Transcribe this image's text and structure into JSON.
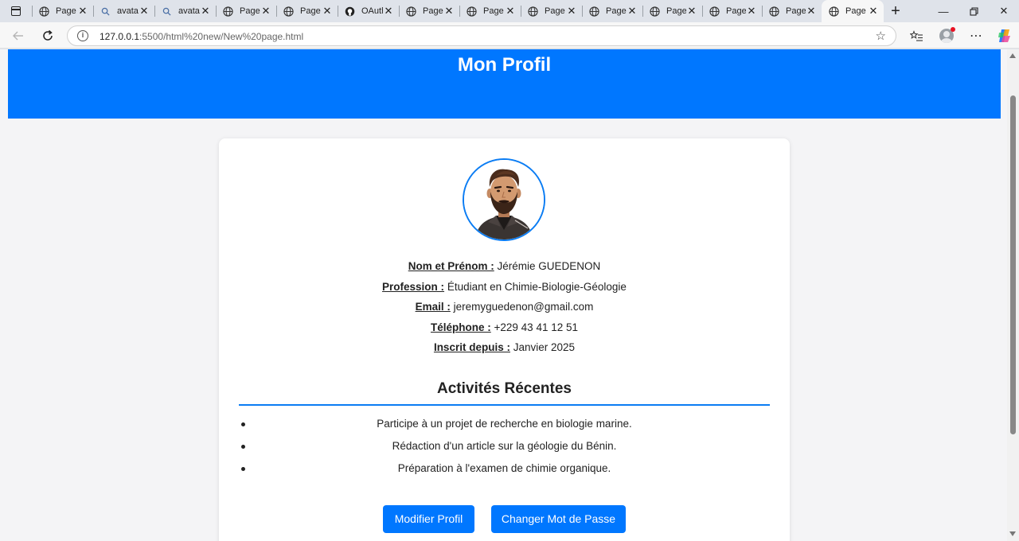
{
  "browser": {
    "tabs": [
      {
        "title": "Page",
        "icon": "globe-icon",
        "active": false
      },
      {
        "title": "avatar",
        "icon": "search-icon",
        "active": false
      },
      {
        "title": "avatar",
        "icon": "search-icon",
        "active": false
      },
      {
        "title": "Page",
        "icon": "globe-icon",
        "active": false
      },
      {
        "title": "Page",
        "icon": "globe-icon",
        "active": false
      },
      {
        "title": "OAuth",
        "icon": "github-icon",
        "active": false
      },
      {
        "title": "Page",
        "icon": "globe-icon",
        "active": false
      },
      {
        "title": "Page",
        "icon": "globe-icon",
        "active": false
      },
      {
        "title": "Page",
        "icon": "globe-icon",
        "active": false
      },
      {
        "title": "Page",
        "icon": "globe-icon",
        "active": false
      },
      {
        "title": "Page",
        "icon": "globe-icon",
        "active": false
      },
      {
        "title": "Page",
        "icon": "globe-icon",
        "active": false
      },
      {
        "title": "Page",
        "icon": "globe-icon",
        "active": false
      },
      {
        "title": "Page",
        "icon": "globe-icon",
        "active": true
      }
    ],
    "url": {
      "host": "127.0.0.1",
      "path": ":5500/html%20new/New%20page.html"
    }
  },
  "page": {
    "header_title": "Mon Profil",
    "profile": {
      "name_label": "Nom et Prénom :",
      "name_value": "Jérémie GUEDENON",
      "profession_label": "Profession :",
      "profession_value": "Étudiant en Chimie-Biologie-Géologie",
      "email_label": "Email :",
      "email_value": "jeremyguedenon@gmail.com",
      "phone_label": "Téléphone :",
      "phone_value": "+229 43 41 12 51",
      "since_label": "Inscrit depuis :",
      "since_value": "Janvier 2025"
    },
    "activities": {
      "title": "Activités Récentes",
      "items": [
        "Participe à un projet de recherche en biologie marine.",
        "Rédaction d'un article sur la géologie du Bénin.",
        "Préparation à l'examen de chimie organique."
      ]
    },
    "buttons": {
      "edit": "Modifier Profil",
      "password": "Changer Mot de Passe"
    },
    "colors": {
      "accent": "#0077ff",
      "background": "#f4f4f6"
    }
  }
}
